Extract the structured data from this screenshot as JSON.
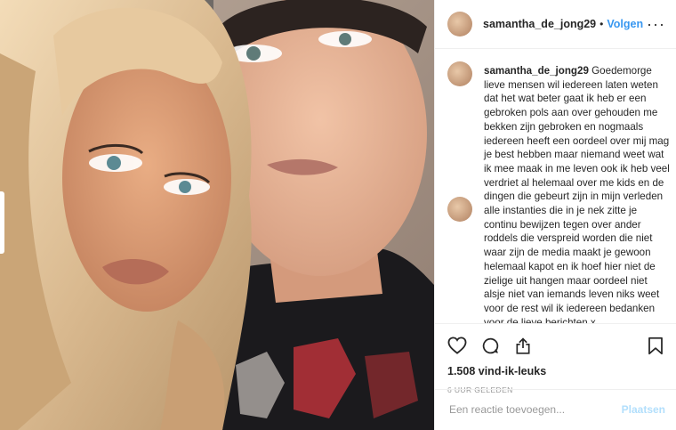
{
  "header": {
    "username": "samantha_de_jong29",
    "separator": "•",
    "follow_label": "Volgen",
    "more_label": "···"
  },
  "caption": {
    "username": "samantha_de_jong29",
    "text": "Goedemorge lieve mensen wil iedereen laten weten dat het wat beter gaat ik heb er een gebroken pols aan over gehouden me bekken zijn gebroken en nogmaals iedereen heeft een oordeel over mij mag je best hebben maar niemand weet wat ik mee maak in me leven ook ik heb veel verdriet al helemaal over me kids en de dingen die gebeurt zijn in mijn verleden alle instanties die in je nek zitte je continu bewijzen tegen over ander roddels die verspreid worden die niet waar zijn de media maakt je gewoon helemaal kapot en ik hoef hier niet de zielige uit hangen maar oordeel niet alsje niet van iemands leven niks weet voor de rest wil ik iedereen bedanken voor de lieve berichten x"
  },
  "post": {
    "likes": "1.508 vind-ik-leuks",
    "time_ago": "6 UUR GELEDEN"
  },
  "comment_box": {
    "placeholder": "Een reactie toevoegen...",
    "post_label": "Plaatsen"
  },
  "icons": {
    "like": "heart-icon",
    "comment": "comment-bubble-icon",
    "share": "share-icon",
    "save": "bookmark-icon",
    "more": "more-dots-icon"
  },
  "colors": {
    "link_blue": "#3897f0",
    "disabled_blue": "#b2dffc",
    "text": "#262626",
    "muted": "#999999",
    "divider": "#efefef"
  }
}
